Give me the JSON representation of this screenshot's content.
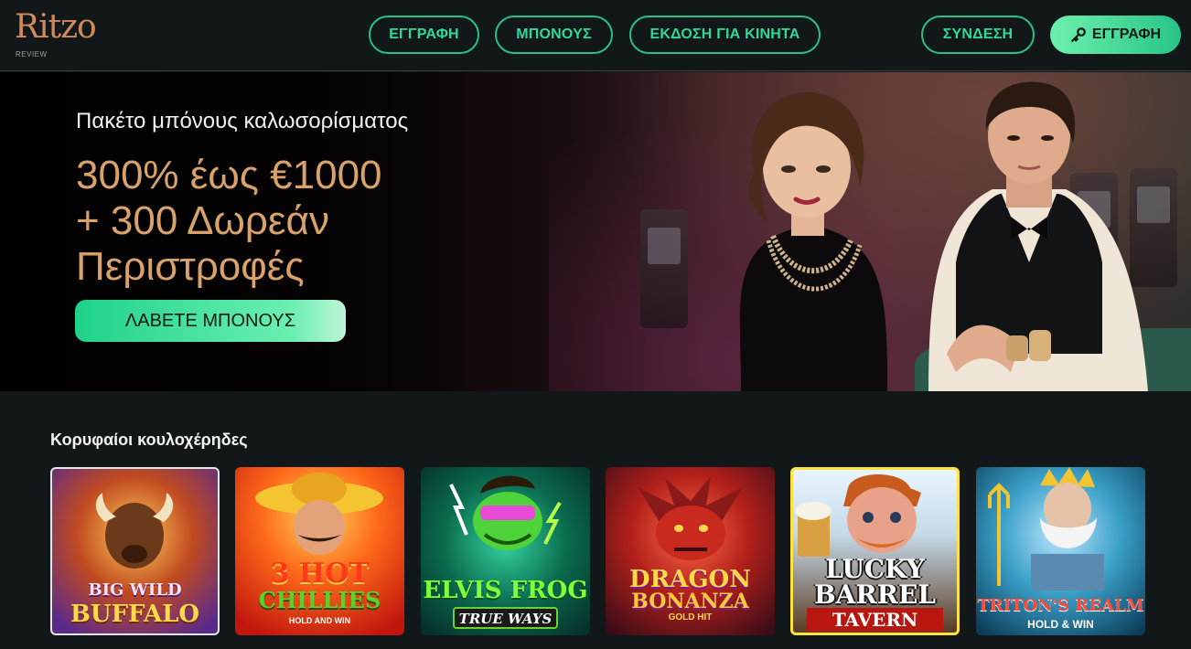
{
  "header": {
    "logo": {
      "word": "Ritzo",
      "sub": "REVIEW"
    },
    "nav": {
      "register": "ΕΓΓΡΑΦΗ",
      "bonus": "ΜΠΟΝΟΥΣ",
      "mobile": "ΕΚΔΟΣΗ ΓΙΑ ΚΙΝΗΤΑ",
      "login": "ΣΥΝΔΕΣΗ",
      "register_cta": "ΕΓΓΡΑΦΗ"
    }
  },
  "hero": {
    "subtitle": "Πακέτο μπόνους καλωσορίσματος",
    "title_line1": "300% έως €1000",
    "title_line2": "+ 300 Δωρεάν",
    "title_line3": "Περιστροφές",
    "cta": "ΛΑΒΕΤΕ ΜΠΟΝΟΥΣ"
  },
  "slots": {
    "title": "Κορυφαίοι κουλοχέρηδες",
    "items": [
      {
        "line1": "BIG WILD",
        "line2": "BUFFALO",
        "line3": ""
      },
      {
        "line1": "3 HOT",
        "line2": "CHILLIES",
        "line3": "HOLD AND WIN"
      },
      {
        "line1": "ELVIS FROG",
        "line2": "TRUE WAYS",
        "line3": "TM"
      },
      {
        "line1": "DRAGON",
        "line2": "BONANZA",
        "line3": "GOLD HIT"
      },
      {
        "line1": "LUCKY",
        "line2": "BARREL",
        "line3": "TAVERN"
      },
      {
        "line1": "TRITON'S REALM",
        "line2": "HOLD & WIN",
        "line3": ""
      }
    ]
  },
  "colors": {
    "accent": "#27c087",
    "background": "#121719",
    "gold": "#d9a26b"
  }
}
